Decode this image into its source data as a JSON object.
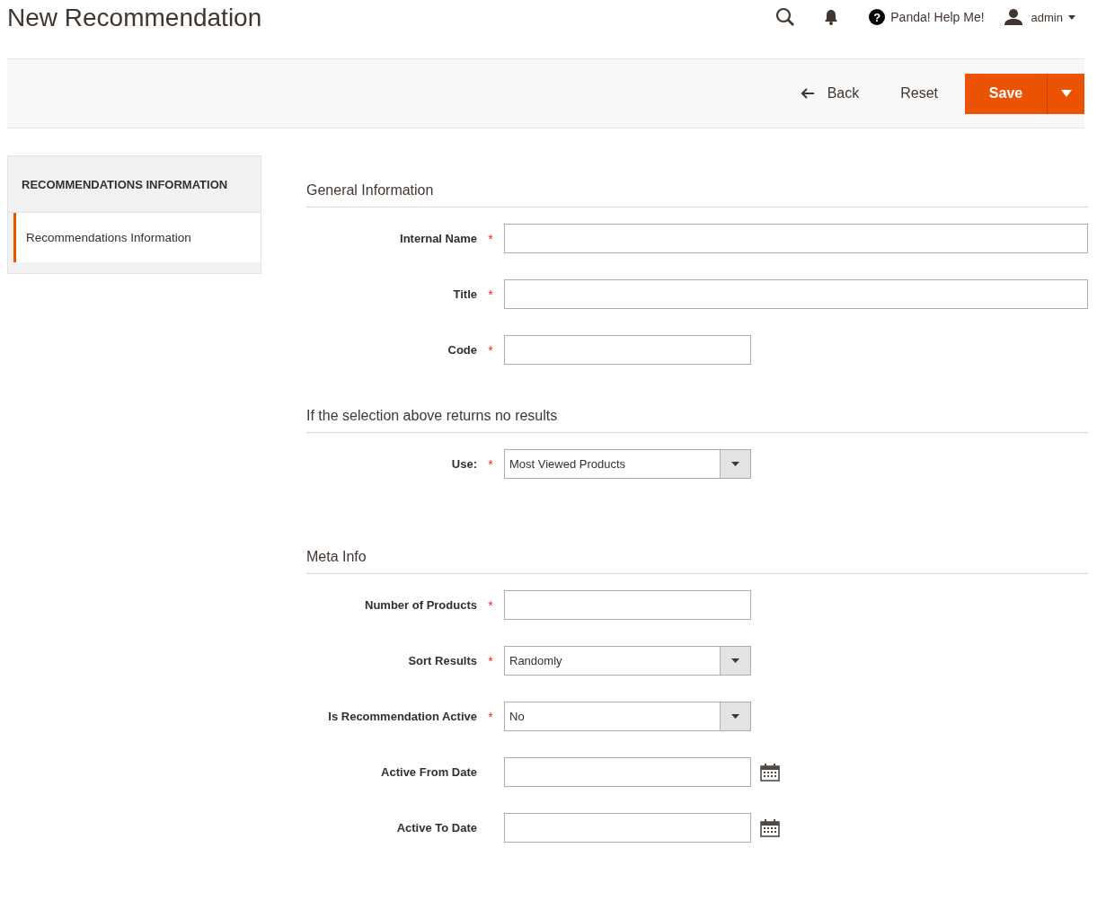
{
  "page_title": "New Recommendation",
  "header": {
    "help_icon_glyph": "?",
    "help_label": "Panda! Help Me!",
    "user_name": "admin"
  },
  "actions": [
    {
      "label": "Back",
      "kind": "back"
    },
    {
      "label": "Reset",
      "kind": "plain"
    },
    {
      "label": "Save",
      "kind": "primary"
    }
  ],
  "sidebar": {
    "title": "RECOMMENDATIONS INFORMATION",
    "items": [
      {
        "label": "Recommendations Information",
        "selected": true
      }
    ]
  },
  "sections": [
    {
      "title": "General Information",
      "fields": [
        {
          "label": "Internal Name",
          "required_mark": "*",
          "kind": "wide-text"
        },
        {
          "label": "Title",
          "required_mark": "*",
          "kind": "wide-text"
        },
        {
          "label": "Code",
          "required_mark": "*",
          "kind": "text"
        }
      ]
    },
    {
      "title": "If the selection above returns no results",
      "fields": [
        {
          "label": "Use:",
          "required_mark": "*",
          "kind": "select",
          "value": "Most Viewed Products"
        }
      ]
    },
    {
      "title": "Meta Info",
      "fields": [
        {
          "label": "Number of Products",
          "required_mark": "*",
          "kind": "text"
        },
        {
          "label": "Sort Results",
          "required_mark": "*",
          "kind": "select",
          "value": "Randomly"
        },
        {
          "label": "Is Recommendation Active",
          "required_mark": "*",
          "kind": "select",
          "value": "No"
        },
        {
          "label": "Active From Date",
          "kind": "date"
        },
        {
          "label": "Active To Date",
          "kind": "date"
        }
      ]
    }
  ]
}
